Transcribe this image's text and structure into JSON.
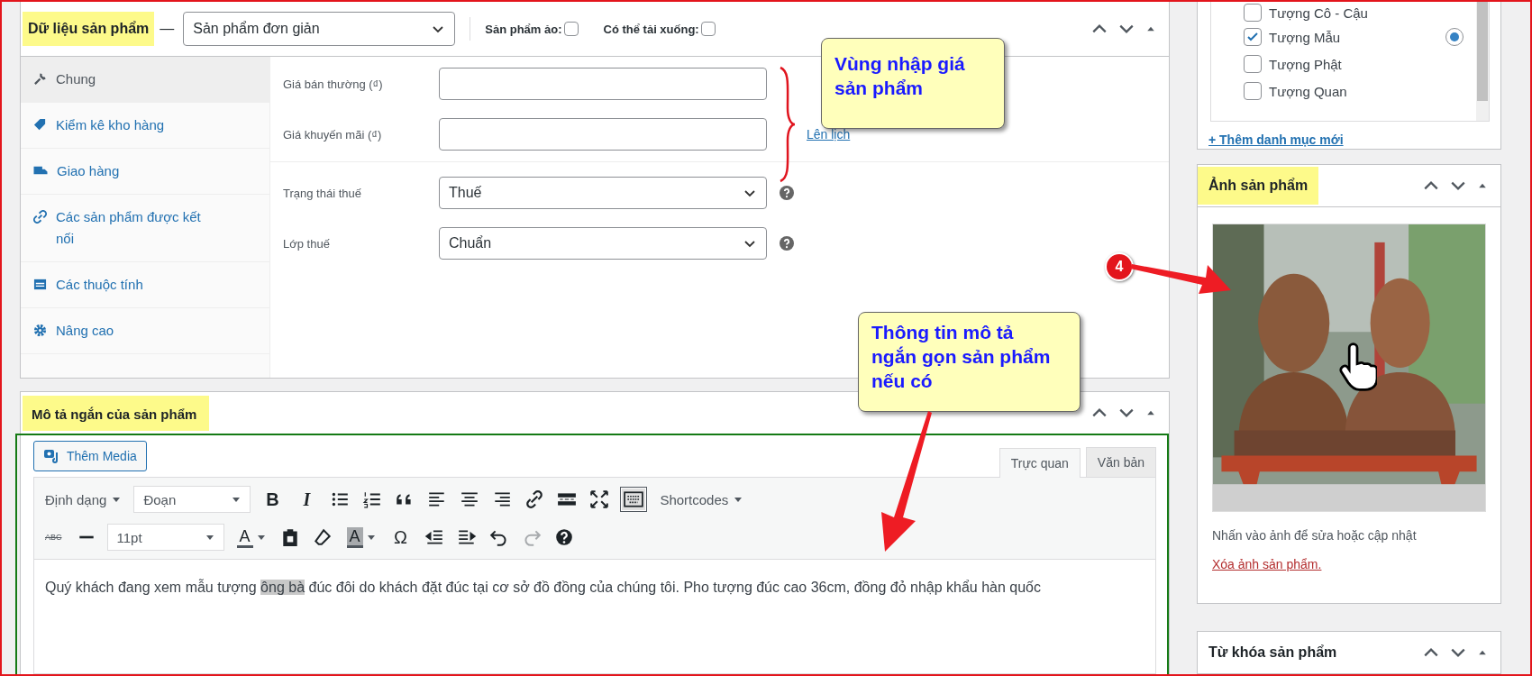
{
  "product_data": {
    "title": "Dữ liệu sản phẩm",
    "dash": "—",
    "type_select": "Sản phẩm đơn giản",
    "options": [
      {
        "label": "Sản phẩm ảo:",
        "checked": false
      },
      {
        "label": "Có thể tải xuống:",
        "checked": false
      }
    ],
    "tabs": [
      {
        "label": "Chung",
        "selected": true
      },
      {
        "label": "Kiểm kê kho hàng",
        "selected": false
      },
      {
        "label": "Giao hàng",
        "selected": false
      },
      {
        "label": "Các sản phẩm được kết nối",
        "selected": false
      },
      {
        "label": "Các thuộc tính",
        "selected": false
      },
      {
        "label": "Nâng cao",
        "selected": false
      }
    ],
    "price_fields": [
      {
        "label": "Giá bán thường (₫)",
        "kind": "input"
      },
      {
        "label": "Giá khuyến mãi (₫)",
        "kind": "input",
        "link": "Lên lịch"
      }
    ],
    "tax_fields": [
      {
        "label": "Trạng thái thuế",
        "kind": "select",
        "value": "Thuế",
        "help": true
      },
      {
        "label": "Lớp thuế",
        "kind": "select",
        "value": "Chuẩn",
        "help": true
      }
    ]
  },
  "short_description": {
    "title": "Mô tả ngắn của sản phẩm",
    "add_media": "Thêm Media",
    "editor_tabs": [
      {
        "label": "Trực quan",
        "selected": true
      },
      {
        "label": "Văn bản",
        "selected": false
      }
    ],
    "format_menu": "Định dạng",
    "block_select": "Đoạn",
    "bold": "B",
    "italic": "I",
    "toolbar_toggle_on": true,
    "shortcodes": "Shortcodes",
    "strike": "ABC",
    "font_size": "11pt",
    "text_color": "A",
    "background_color": "A",
    "special_char": "Ω",
    "content": [
      {
        "text": "Quý khách đang xem mẫu tượng ",
        "highlighted": false
      },
      {
        "text": "ông bà",
        "highlighted": true
      },
      {
        "text": " đúc đôi do khách đặt đúc tại cơ sở đồ đồng của chúng tôi. Pho tượng đúc cao 36cm, đồng đỏ nhập khẩu hàn quốc",
        "highlighted": false
      }
    ]
  },
  "categories": {
    "items": [
      {
        "label": "Tượng Cô - Cậu",
        "checked": false,
        "primary": false
      },
      {
        "label": "Tượng Mẫu",
        "checked": true,
        "primary": true
      },
      {
        "label": "Tượng Phật",
        "checked": false,
        "primary": false
      },
      {
        "label": "Tượng Quan",
        "checked": false,
        "primary": false
      }
    ],
    "add_link": "+ Thêm danh mục mới"
  },
  "product_image": {
    "title": "Ảnh sản phẩm",
    "hint": "Nhấn vào ảnh để sửa hoặc cập nhật",
    "remove_link": "Xóa ảnh sản phẩm."
  },
  "product_tags": {
    "title": "Từ khóa sản phẩm"
  },
  "annotations": {
    "price_callout": "Vùng nhập giá sản phẩm",
    "description_callout": "Thông tin mô tả ngắn gọn sản phẩm nếu có",
    "step_marker": "4"
  }
}
